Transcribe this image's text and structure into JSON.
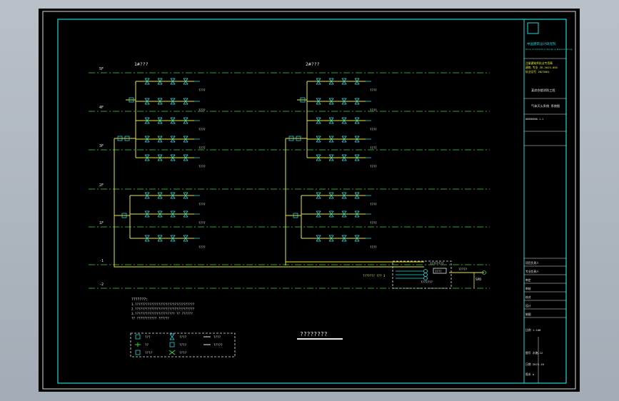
{
  "floors": [
    "5F",
    "4F",
    "3F",
    "2F",
    "1F",
    "-1",
    "-2"
  ],
  "groups": [
    {
      "title": "1#???"
    },
    {
      "title": "2#???"
    }
  ],
  "branch_tags": [
    "????",
    "????",
    "????",
    "????",
    "????",
    "????",
    "????"
  ],
  "device": {
    "top_label": "????????",
    "box_label": "????",
    "bottom_label": "???????",
    "left_label": "??????? ??? 3",
    "right_label": "SPD",
    "arrow_label": "?????"
  },
  "notes": {
    "title": "???????:",
    "lines": [
      "1.?????????????????????????????????",
      "2.?????????????????????????????????",
      "3.?????????????????????? ?? ??????",
      "  ?? ??????????? ??????"
    ]
  },
  "legend": [
    {
      "symbol": "valve",
      "label": "???"
    },
    {
      "symbol": "tee",
      "label": "??"
    },
    {
      "symbol": "valve",
      "label": "????"
    },
    {
      "symbol": "nozzle",
      "label": "????"
    },
    {
      "symbol": "valve",
      "label": "????"
    },
    {
      "symbol": "cross",
      "label": "????"
    },
    {
      "symbol": "line",
      "label": "????"
    },
    {
      "symbol": "arrow",
      "label": "?????"
    }
  ],
  "drawing_title": "????????",
  "title_block": {
    "institute": "中国建筑设计研究院",
    "institute_en": "China Architecture Design & Research Group",
    "stamp_lines": [
      "注册建筑师执业专用章",
      "建筑-专业 ZR-2023-085",
      "执业证号 2023001"
    ],
    "project": "某综合楼消防工程",
    "subproject": "气体灭火系统 系统图",
    "sheet_no": "00000000-1-1",
    "row_labels": [
      "项目负责人",
      "专业负责人",
      "审定",
      "审核",
      "校对",
      "设计",
      "制图"
    ],
    "scale": "比例 1:100",
    "drawing_no": "图号 水施-12",
    "date": "日期 2023.10",
    "revision": "版本 A"
  }
}
